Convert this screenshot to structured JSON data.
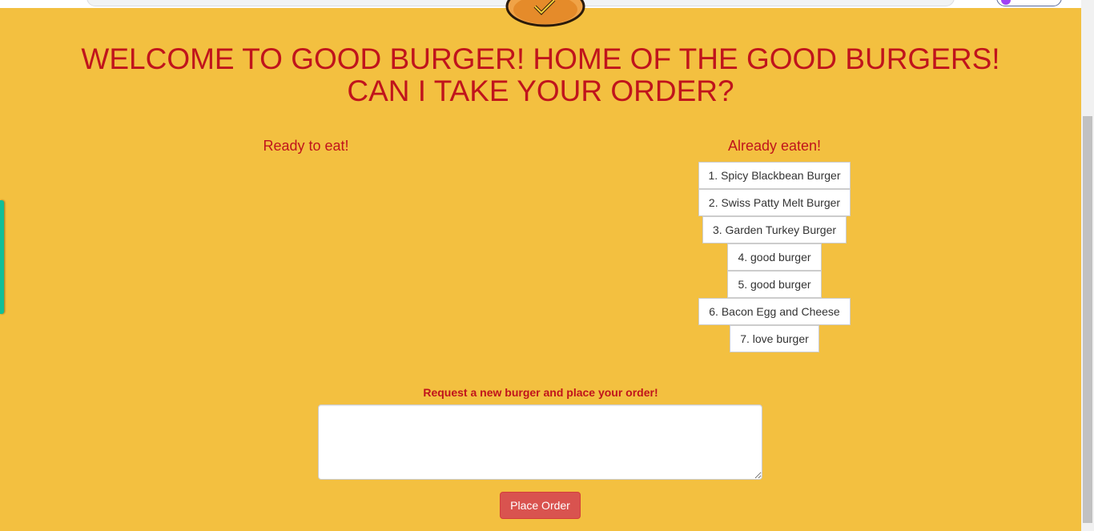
{
  "header": {
    "title_line1": "WELCOME TO GOOD BURGER! HOME OF THE GOOD BURGERS!",
    "title_line2": "CAN I TAKE YOUR ORDER?"
  },
  "ready_column": {
    "title": "Ready to eat!",
    "items": []
  },
  "eaten_column": {
    "title": "Already eaten!",
    "items": [
      {
        "label": "1. Spicy Blackbean Burger"
      },
      {
        "label": "2. Swiss Patty Melt Burger"
      },
      {
        "label": "3. Garden Turkey Burger"
      },
      {
        "label": "4. good burger"
      },
      {
        "label": "5. good burger"
      },
      {
        "label": "6. Bacon Egg and Cheese"
      },
      {
        "label": "7. love burger"
      }
    ]
  },
  "order_form": {
    "label": "Request a new burger and place your order!",
    "input_value": "",
    "submit_label": "Place Order"
  },
  "colors": {
    "background": "#f3c040",
    "text_accent": "#c0141c",
    "button_danger": "#d9534f",
    "side_tab": "#0fbf98"
  },
  "icons": {
    "logo": "burger-logo-icon"
  }
}
